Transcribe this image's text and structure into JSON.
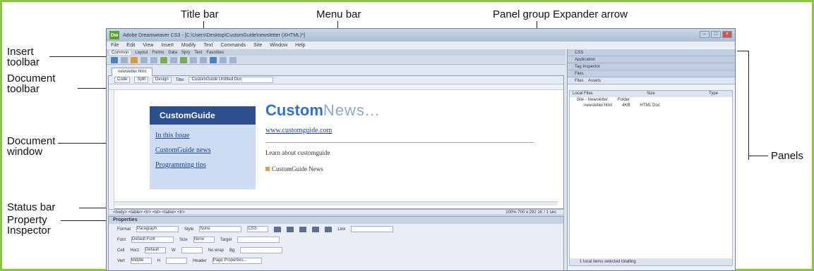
{
  "callouts": {
    "title_bar": "Title bar",
    "menu_bar": "Menu bar",
    "panel_expander": "Panel group Expander arrow",
    "insert_toolbar_line1": "Insert",
    "insert_toolbar_line2": "toolbar",
    "document_toolbar_line1": "Document",
    "document_toolbar_line2": "toolbar",
    "document_window_line1": "Document",
    "document_window_line2": "window",
    "status_bar": "Status bar",
    "property_inspector_line1": "Property",
    "property_inspector_line2": "Inspector",
    "panels": "Panels"
  },
  "app": {
    "title": "Adobe Dreamweaver CS3 - [C:\\Users\\Desktop\\CustomGuide\\newsletter (XHTML)*]",
    "logo": "Dw",
    "menu": [
      "File",
      "Edit",
      "View",
      "Insert",
      "Modify",
      "Text",
      "Commands",
      "Site",
      "Window",
      "Help"
    ],
    "insert_tabs": [
      "Common",
      "Layout",
      "Forms",
      "Data",
      "Spry",
      "Text",
      "Favorites"
    ],
    "doc_tab": "newsletter.html",
    "doc_toolbar": {
      "code": "Code",
      "split": "Split",
      "design": "Design",
      "title_label": "Title:",
      "title_value": "CustomGuide Untitled Doc"
    },
    "page": {
      "nav_head": "CustomGuide",
      "nav_links": [
        "In this Issue",
        "CustomGuide news",
        "Programming tips"
      ],
      "brand_bold": "Custom",
      "brand_light": "News...",
      "url": "www.customguide.com",
      "about": "Learn about customguide",
      "news": "CustomGuide News"
    },
    "status_left": "<body> <table> <tr> <td> <table> <tr>",
    "status_right": "100%  700 x 292  1K / 1 sec",
    "properties": {
      "head": "Properties",
      "format_label": "Format",
      "format_value": "Paragraph",
      "style_label": "Style",
      "style_value": "None",
      "css_label": "CSS",
      "link_label": "Link",
      "font_label": "Font",
      "font_value": "Default Font",
      "size_label": "Size",
      "size_value": "None",
      "target_label": "Target",
      "cell_label": "Cell",
      "horz_label": "Horz",
      "horz_value": "Default",
      "vert_label": "Vert",
      "vert_value": "Middle",
      "w_label": "W",
      "h_label": "H",
      "nowrap_label": "No wrap",
      "header_label": "Header",
      "bg_label": "Bg",
      "page_props": "Page Properties..."
    },
    "panels": {
      "groups": [
        "CSS",
        "Application",
        "Tag Inspector",
        "Files"
      ],
      "files_tab": "Files",
      "assets_tab": "Assets",
      "col_local": "Local Files",
      "col_size": "Size",
      "col_type": "Type",
      "rows": [
        {
          "name": "Site - Newsletter",
          "size": "",
          "type": "Folder"
        },
        {
          "name": "newsletter.html",
          "size": "4KB",
          "type": "HTML Doc"
        }
      ],
      "footer": "1 local items selected totalling"
    }
  }
}
